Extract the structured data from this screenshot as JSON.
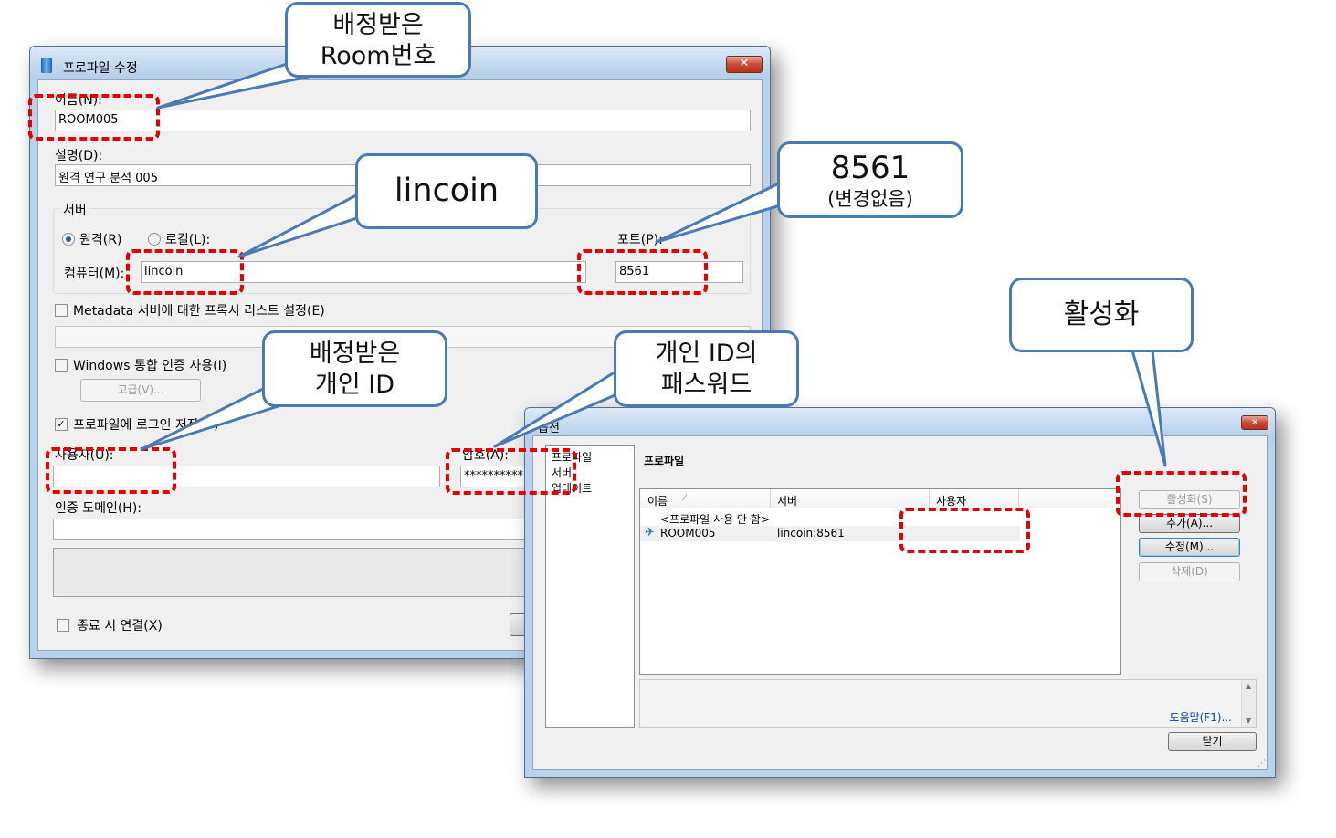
{
  "profile_edit": {
    "title": "프로파일 수정",
    "close": "✕",
    "name_label": "이름(N):",
    "name_value": "ROOM005",
    "desc_label": "설명(D):",
    "desc_value": "원격 연구 분석 005",
    "server_group": "서버",
    "remote_label": "원격(R)",
    "local_label": "로컬(L):",
    "computer_label": "컴퓨터(M):",
    "computer_value": "lincoin",
    "port_label": "포트(P):",
    "port_value": "8561",
    "metadata_label": "Metadata 서버에 대한 프록시 리스트 설정(E)",
    "windows_auth_label": "Windows 통합 인증 사용(I)",
    "advanced_button": "고급(V)...",
    "save_login_label": "프로파일에 로그인 저장(O)",
    "user_label": "사용자(U):",
    "user_value": "",
    "password_label": "암호(A):",
    "password_value": "**********",
    "auth_domain_label": "인증 도메인(H):",
    "connect_on_exit_label": "종료 시 연결(X)"
  },
  "options": {
    "title": "옵션",
    "close": "✕",
    "nav": [
      "프로파일",
      "서버",
      "업데이트"
    ],
    "section_title": "프로파일",
    "columns": [
      "이름",
      "서버",
      "사용자"
    ],
    "rows": [
      {
        "name": "<프로파일 사용 안 함>",
        "server": "",
        "user": ""
      },
      {
        "name": "ROOM005",
        "server": "lincoin:8561",
        "user": ""
      }
    ],
    "buttons": {
      "activate": "활성화(S)",
      "add": "추가(A)...",
      "edit": "수정(M)...",
      "delete": "삭제(D)"
    },
    "help_link": "도움말(F1)...",
    "close_button": "닫기"
  },
  "callouts": {
    "room": {
      "line1": "배정받은",
      "line2": "Room번호"
    },
    "lincoin": {
      "line1": "lincoin"
    },
    "port": {
      "line1": "8561",
      "line2": "(변경없음)"
    },
    "activate": {
      "line1": "활성화"
    },
    "user_id": {
      "line1": "배정받은",
      "line2": "개인 ID"
    },
    "password": {
      "line1": "개인 ID의",
      "line2": "패스워드"
    }
  },
  "colors": {
    "callout_border": "#4a7ab5",
    "highlight": "#e60000",
    "link": "#0645ad"
  }
}
